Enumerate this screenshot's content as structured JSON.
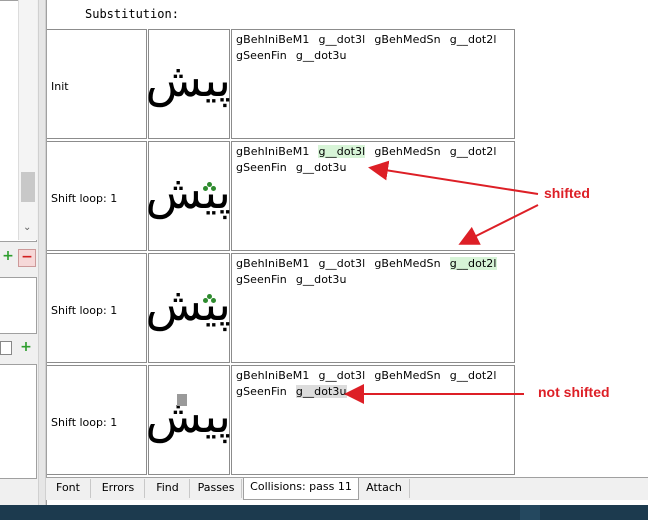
{
  "window": {
    "substitution_label": "Substitution:"
  },
  "left_panel": {
    "add_icon": "+",
    "remove_icon": "−",
    "scroll_down_icon": "⌄"
  },
  "rows": [
    {
      "label": "Init",
      "line1": [
        "gBehIniBeM1",
        "g__dot3l",
        "gBehMedSn",
        "g__dot2l"
      ],
      "line2": [
        "gSeenFin",
        "g__dot3u"
      ],
      "glyph": "پیش"
    },
    {
      "label": "Shift loop: 1",
      "line1": [
        "gBehIniBeM1",
        "g__dot3l",
        "gBehMedSn",
        "g__dot2l"
      ],
      "line2": [
        "gSeenFin",
        "g__dot3u"
      ],
      "glyph": "پیش"
    },
    {
      "label": "Shift loop: 1",
      "line1": [
        "gBehIniBeM1",
        "g__dot3l",
        "gBehMedSn",
        "g__dot2l"
      ],
      "line2": [
        "gSeenFin",
        "g__dot3u"
      ],
      "glyph": "پیش"
    },
    {
      "label": "Shift loop: 1",
      "line1": [
        "gBehIniBeM1",
        "g__dot3l",
        "gBehMedSn",
        "g__dot2l"
      ],
      "line2": [
        "gSeenFin",
        "g__dot3u"
      ],
      "glyph": "پیش"
    }
  ],
  "tabs": [
    "Font",
    "Errors",
    "Find",
    "Passes",
    "Collisions: pass 11",
    "Attach"
  ],
  "active_tab": "Collisions: pass 11",
  "annotations": {
    "shifted": "shifted",
    "not_shifted": "not shifted",
    "color": "#dd1f26"
  },
  "colors": {
    "highlight_green": "#d7f4d7",
    "highlight_gray": "#dcdcdc",
    "dot_green": "#4caf50",
    "dot_gray": "#9a9a9a"
  }
}
